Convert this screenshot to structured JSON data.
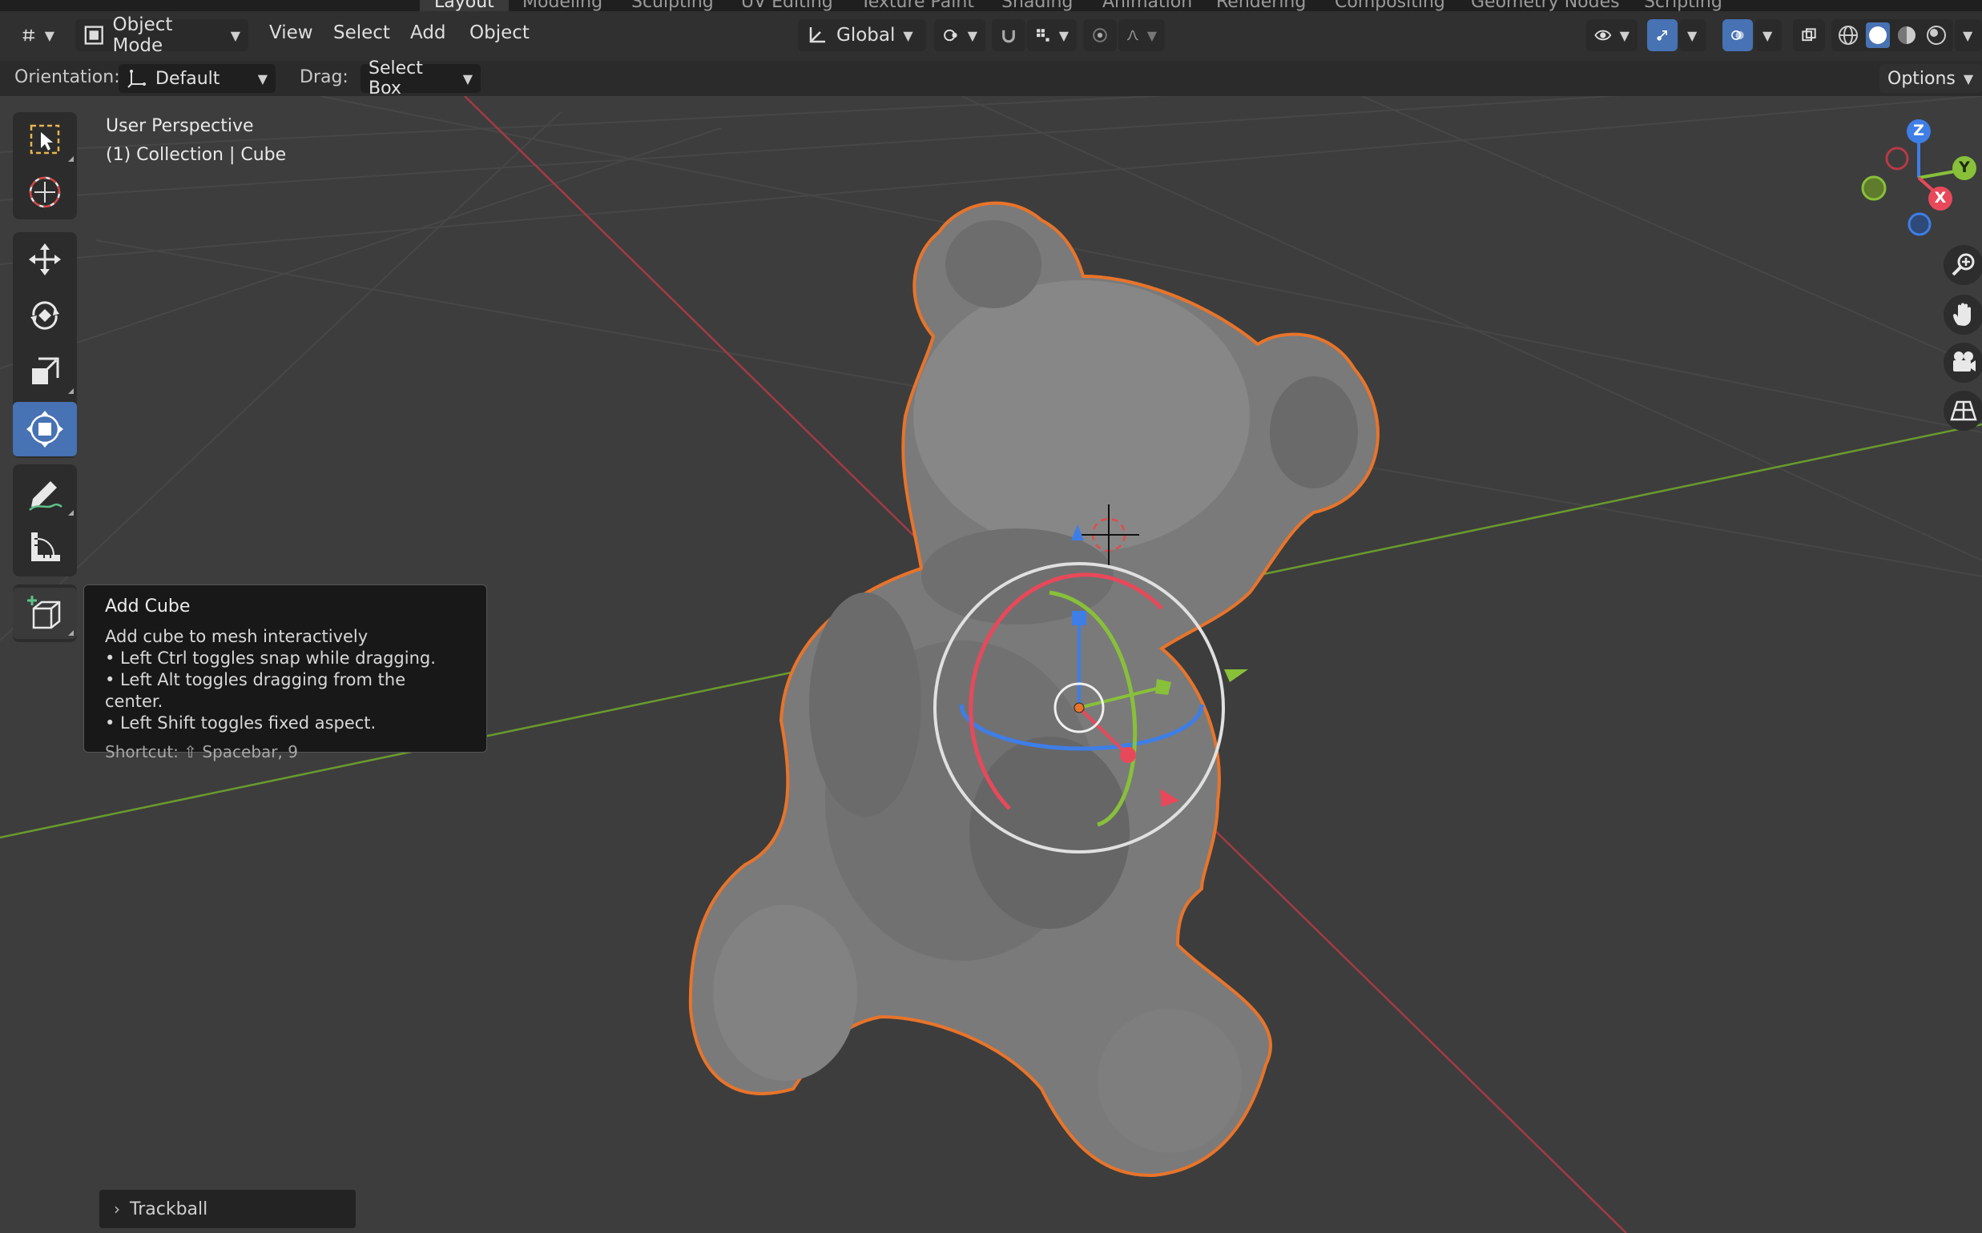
{
  "workspace_tabs": [
    {
      "label": "Layout",
      "active": true
    },
    {
      "label": "Modeling"
    },
    {
      "label": "Sculpting"
    },
    {
      "label": "UV Editing"
    },
    {
      "label": "Texture Paint"
    },
    {
      "label": "Shading"
    },
    {
      "label": "Animation"
    },
    {
      "label": "Rendering"
    },
    {
      "label": "Compositing"
    },
    {
      "label": "Geometry Nodes"
    },
    {
      "label": "Scripting"
    }
  ],
  "header": {
    "mode_label": "Object Mode",
    "menus": [
      "View",
      "Select",
      "Add",
      "Object"
    ],
    "transform_orientation": "Global"
  },
  "tool_settings": {
    "orientation_label": "Orientation:",
    "orientation_value": "Default",
    "drag_label": "Drag:",
    "drag_value": "Select Box",
    "options_label": "Options"
  },
  "viewport_info": {
    "view_name": "User Perspective",
    "object_path": "(1) Collection | Cube"
  },
  "tooltip": {
    "title": "Add Cube",
    "description": "Add cube to mesh interactively",
    "bullets": [
      "• Left Ctrl toggles snap while dragging.",
      "• Left Alt toggles dragging from the center.",
      "• Left Shift toggles fixed aspect."
    ],
    "shortcut": "Shortcut: ⇧ Spacebar, 9"
  },
  "redo_panel": {
    "label": "Trackball"
  },
  "gizmo": {
    "z_label": "Z",
    "y_label": "Y",
    "x_label": "X"
  },
  "colors": {
    "accent_blue": "#4772b3",
    "axis_x": "#e8495a",
    "axis_y": "#88c03a",
    "axis_z": "#3e7ee6",
    "selection_outline": "#e8742a"
  }
}
